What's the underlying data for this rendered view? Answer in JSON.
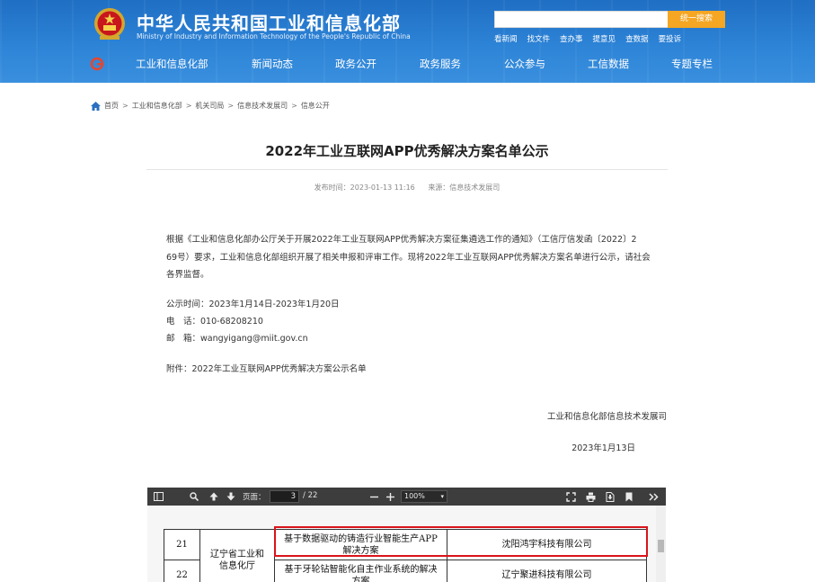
{
  "header": {
    "title_cn": "中华人民共和国工业和信息化部",
    "title_en": "Ministry of Industry and Information Technology of the People's Republic of China",
    "search_button": "统一搜索",
    "quick_links": [
      "看新闻",
      "找文件",
      "查办事",
      "提意见",
      "查数据",
      "要投诉"
    ],
    "nav": [
      "工业和信息化部",
      "新闻动态",
      "政务公开",
      "政务服务",
      "公众参与",
      "工信数据",
      "专题专栏"
    ],
    "colors": {
      "bar": "#2d83d6",
      "search_btn": "#f5a623"
    }
  },
  "breadcrumb": [
    "首页",
    "工业和信息化部",
    "机关司局",
    "信息技术发展司",
    "信息公开"
  ],
  "article": {
    "title": "2022年工业互联网APP优秀解决方案名单公示",
    "published": "发布时间：2023-01-13 11:16",
    "source": "来源：信息技术发展司",
    "body_line1": "根据《工业和信息化部办公厅关于开展2022年工业互联网APP优秀解决方案征集遴选工作的通知》（工信厅信发函〔2022〕2",
    "body_line2": "69号）要求，工业和信息化部组织开展了相关申报和评审工作。现将2022年工业互联网APP优秀解决方案名单进行公示，请社会",
    "body_line3": "各界监督。",
    "period_label": "公示时间：",
    "period": "2023年1月14日-2023年1月20日",
    "phone_label": "电　话：",
    "phone": "010-68208210",
    "email_label": "邮　箱：",
    "email": "wangyigang@miit.gov.cn",
    "attachment": "附件：2022年工业互联网APP优秀解决方案公示名单",
    "signature": "工业和信息化部信息技术发展司",
    "date": "2023年1月13日"
  },
  "pdf_viewer": {
    "page_label": "页面：",
    "current_page": "3",
    "total_pages": "/ 22",
    "zoom": "100%",
    "rows": [
      {
        "no": "21",
        "province": "辽宁省工业和信息化厅",
        "solution": "基于数据驱动的铸造行业智能生产APP解决方案",
        "company": "沈阳鸿宇科技有限公司"
      },
      {
        "no": "22",
        "province": "",
        "solution": "基于牙轮钻智能化自主作业系统的解决方案",
        "company": "辽宁聚进科技有限公司"
      }
    ],
    "highlight_color": "#d9141b"
  }
}
